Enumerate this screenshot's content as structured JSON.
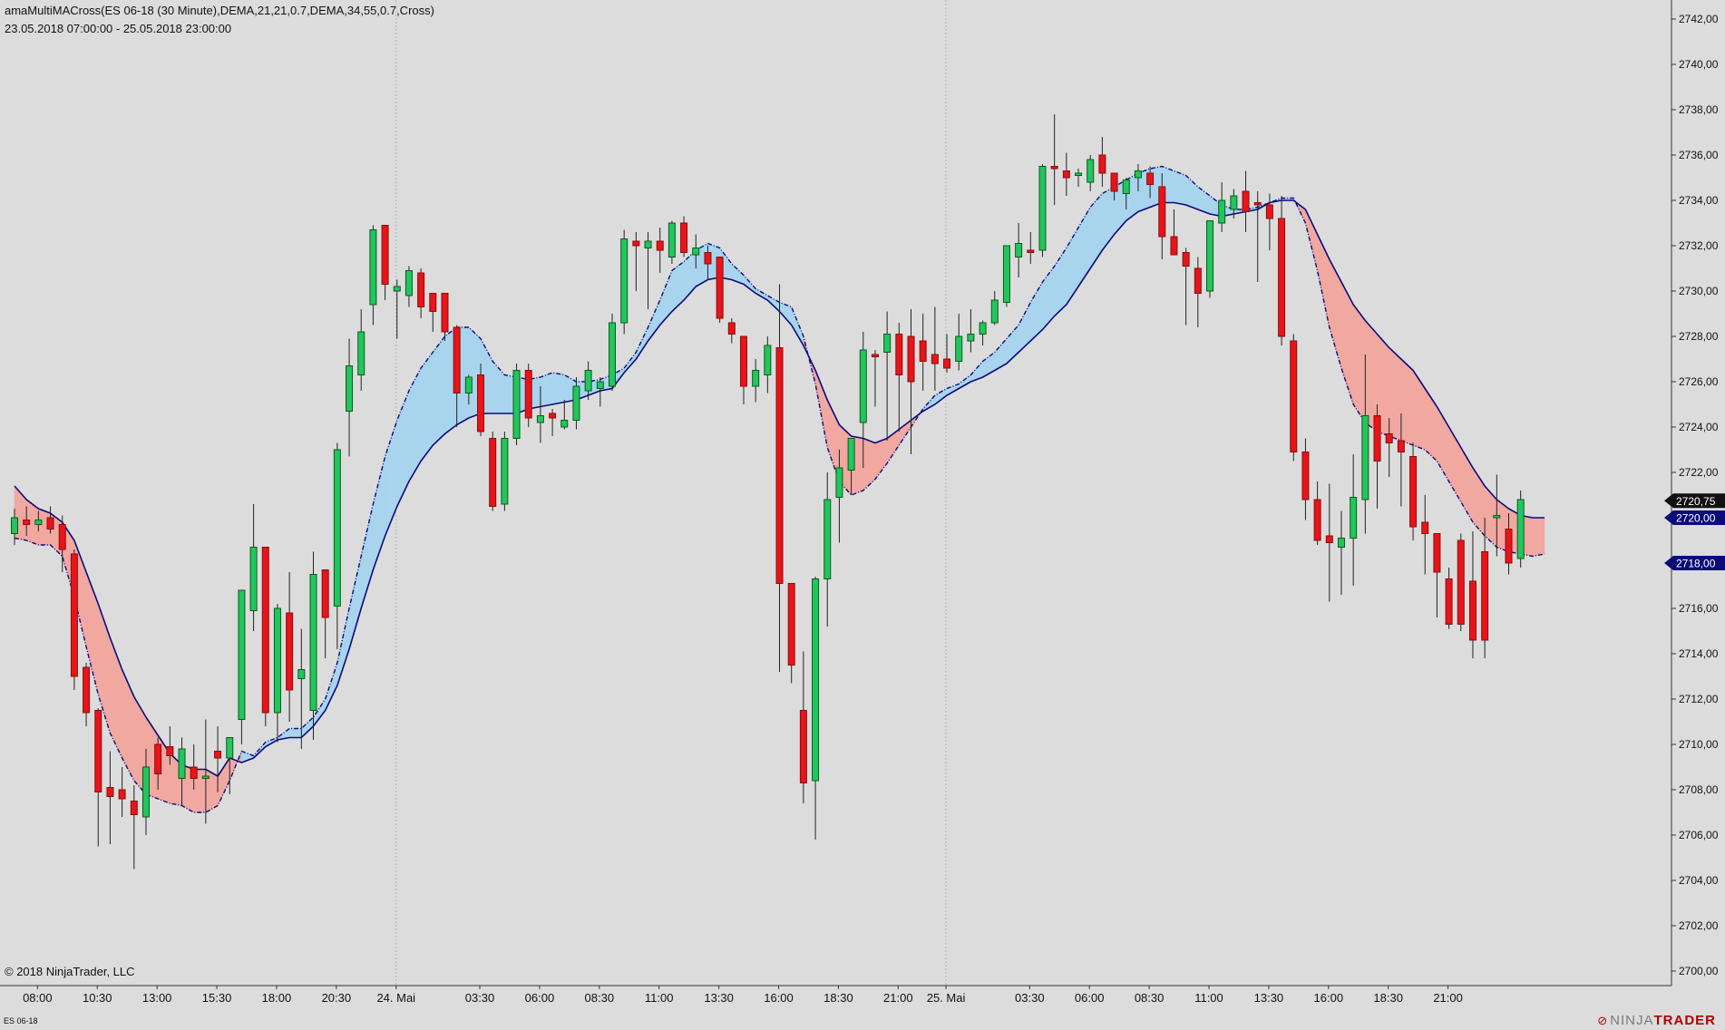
{
  "header": {
    "title": "amaMultiMACross(ES 06-18 (30 Minute),DEMA,21,21,0.7,DEMA,34,55,0.7,Cross)",
    "range": "23.05.2018 07:00:00 - 25.05.2018 23:00:00"
  },
  "footer": {
    "copyright": "© 2018 NinjaTrader, LLC",
    "instrument": "ES 06-18",
    "brand_prefix": "NINJA",
    "brand_suffix": "TRADER",
    "brand_mark": "⊘"
  },
  "colors": {
    "background": "#dcdcdc",
    "up_candle": "#22c55e",
    "up_candle_dark": "#0a5c17",
    "down_candle": "#e8141a",
    "down_candle_dark": "#8b0d0d",
    "bull_cloud": "#a8d4ee",
    "bear_cloud": "#f0a8a0",
    "ma_line": "#0b0b7a",
    "last_price_tag": "#111111",
    "ma_tag": "#0b0b7a"
  },
  "chart_data": {
    "type": "candlestick",
    "instrument": "ES 06-18",
    "interval": "30 Minute",
    "y_axis": {
      "min": 2699,
      "max": 2743,
      "tick_labels": [
        "2700,00",
        "2702,00",
        "2704,00",
        "2706,00",
        "2708,00",
        "2710,00",
        "2712,00",
        "2714,00",
        "2716,00",
        "2718,00",
        "2720,00",
        "2722,00",
        "2724,00",
        "2726,00",
        "2728,00",
        "2730,00",
        "2732,00",
        "2734,00",
        "2736,00",
        "2738,00",
        "2740,00",
        "2742,00"
      ],
      "tick_values": [
        2700,
        2702,
        2704,
        2706,
        2708,
        2710,
        2712,
        2714,
        2716,
        2718,
        2720,
        2722,
        2724,
        2726,
        2728,
        2730,
        2732,
        2734,
        2736,
        2738,
        2740,
        2742
      ]
    },
    "x_axis": {
      "tick_labels": [
        "08:00",
        "10:30",
        "13:00",
        "15:30",
        "18:00",
        "20:30",
        "24. Mai",
        "03:30",
        "06:00",
        "08:30",
        "11:00",
        "13:30",
        "16:00",
        "18:30",
        "21:00",
        "25. Mai",
        "03:30",
        "06:00",
        "08:30",
        "11:00",
        "13:30",
        "16:00",
        "18:30",
        "21:00"
      ],
      "tick_bars": [
        2,
        7,
        12,
        17,
        22,
        27,
        32,
        39,
        44,
        49,
        54,
        59,
        64,
        69,
        74,
        78,
        85,
        90,
        95,
        100,
        105,
        110,
        115,
        120
      ],
      "day_separators": [
        32,
        78
      ]
    },
    "candles": [
      {
        "o": 2719.3,
        "h": 2720.4,
        "l": 2718.8,
        "c": 2720.0
      },
      {
        "o": 2719.9,
        "h": 2720.5,
        "l": 2719.2,
        "c": 2719.7
      },
      {
        "o": 2719.7,
        "h": 2720.3,
        "l": 2719.4,
        "c": 2719.9
      },
      {
        "o": 2720.0,
        "h": 2720.5,
        "l": 2719.3,
        "c": 2719.5
      },
      {
        "o": 2719.7,
        "h": 2720.1,
        "l": 2717.6,
        "c": 2718.6
      },
      {
        "o": 2718.4,
        "h": 2718.6,
        "l": 2712.4,
        "c": 2713.0
      },
      {
        "o": 2713.4,
        "h": 2713.6,
        "l": 2710.8,
        "c": 2711.4
      },
      {
        "o": 2711.5,
        "h": 2711.6,
        "l": 2705.5,
        "c": 2707.9
      },
      {
        "o": 2708.1,
        "h": 2709.7,
        "l": 2705.6,
        "c": 2707.7
      },
      {
        "o": 2708.0,
        "h": 2709.0,
        "l": 2706.8,
        "c": 2707.6
      },
      {
        "o": 2707.5,
        "h": 2708.2,
        "l": 2704.5,
        "c": 2706.9
      },
      {
        "o": 2706.8,
        "h": 2709.8,
        "l": 2706.0,
        "c": 2709.0
      },
      {
        "o": 2710.0,
        "h": 2710.3,
        "l": 2708.0,
        "c": 2708.7
      },
      {
        "o": 2709.9,
        "h": 2710.8,
        "l": 2709.1,
        "c": 2709.5
      },
      {
        "o": 2708.5,
        "h": 2710.3,
        "l": 2707.3,
        "c": 2709.8
      },
      {
        "o": 2709.0,
        "h": 2710.0,
        "l": 2708.0,
        "c": 2708.5
      },
      {
        "o": 2708.5,
        "h": 2711.1,
        "l": 2706.5,
        "c": 2708.6
      },
      {
        "o": 2709.7,
        "h": 2710.8,
        "l": 2707.9,
        "c": 2709.4
      },
      {
        "o": 2709.4,
        "h": 2710.3,
        "l": 2707.8,
        "c": 2710.3
      },
      {
        "o": 2711.1,
        "h": 2711.5,
        "l": 2710.0,
        "c": 2716.8
      },
      {
        "o": 2715.9,
        "h": 2720.6,
        "l": 2715.0,
        "c": 2718.7
      },
      {
        "o": 2718.7,
        "h": 2718.7,
        "l": 2710.8,
        "c": 2711.4
      },
      {
        "o": 2711.4,
        "h": 2716.2,
        "l": 2710.1,
        "c": 2716.0
      },
      {
        "o": 2715.8,
        "h": 2717.6,
        "l": 2711.0,
        "c": 2712.4
      },
      {
        "o": 2712.9,
        "h": 2715.1,
        "l": 2709.8,
        "c": 2713.3
      },
      {
        "o": 2711.5,
        "h": 2718.5,
        "l": 2710.2,
        "c": 2717.5
      },
      {
        "o": 2717.7,
        "h": 2717.7,
        "l": 2713.8,
        "c": 2715.6
      },
      {
        "o": 2716.1,
        "h": 2723.3,
        "l": 2714.2,
        "c": 2723.0
      },
      {
        "o": 2724.7,
        "h": 2727.9,
        "l": 2722.7,
        "c": 2726.7
      },
      {
        "o": 2726.3,
        "h": 2729.2,
        "l": 2725.6,
        "c": 2728.2
      },
      {
        "o": 2729.4,
        "h": 2732.9,
        "l": 2728.5,
        "c": 2732.7
      },
      {
        "o": 2732.9,
        "h": 2732.9,
        "l": 2729.6,
        "c": 2730.3
      },
      {
        "o": 2730.0,
        "h": 2730.5,
        "l": 2727.9,
        "c": 2730.2
      },
      {
        "o": 2729.8,
        "h": 2731.1,
        "l": 2729.3,
        "c": 2730.9
      },
      {
        "o": 2730.8,
        "h": 2731.0,
        "l": 2728.8,
        "c": 2729.3
      },
      {
        "o": 2729.9,
        "h": 2729.9,
        "l": 2728.2,
        "c": 2729.1
      },
      {
        "o": 2729.9,
        "h": 2729.9,
        "l": 2727.8,
        "c": 2728.2
      },
      {
        "o": 2728.4,
        "h": 2728.5,
        "l": 2724.0,
        "c": 2725.5
      },
      {
        "o": 2725.5,
        "h": 2726.3,
        "l": 2725.0,
        "c": 2726.2
      },
      {
        "o": 2726.3,
        "h": 2726.8,
        "l": 2723.6,
        "c": 2723.8
      },
      {
        "o": 2723.5,
        "h": 2723.8,
        "l": 2720.3,
        "c": 2720.5
      },
      {
        "o": 2720.6,
        "h": 2723.8,
        "l": 2720.3,
        "c": 2723.5
      },
      {
        "o": 2723.5,
        "h": 2726.8,
        "l": 2723.2,
        "c": 2726.5
      },
      {
        "o": 2726.5,
        "h": 2726.8,
        "l": 2724.0,
        "c": 2724.4
      },
      {
        "o": 2724.2,
        "h": 2725.8,
        "l": 2723.3,
        "c": 2724.5
      },
      {
        "o": 2724.6,
        "h": 2724.8,
        "l": 2723.6,
        "c": 2724.4
      },
      {
        "o": 2724.0,
        "h": 2725.2,
        "l": 2723.9,
        "c": 2724.3
      },
      {
        "o": 2724.3,
        "h": 2726.2,
        "l": 2723.9,
        "c": 2725.8
      },
      {
        "o": 2725.6,
        "h": 2726.9,
        "l": 2725.2,
        "c": 2726.5
      },
      {
        "o": 2725.7,
        "h": 2726.2,
        "l": 2724.9,
        "c": 2726.0
      },
      {
        "o": 2725.8,
        "h": 2729.0,
        "l": 2725.6,
        "c": 2728.6
      },
      {
        "o": 2728.6,
        "h": 2732.7,
        "l": 2728.1,
        "c": 2732.3
      },
      {
        "o": 2732.2,
        "h": 2732.6,
        "l": 2730.0,
        "c": 2732.0
      },
      {
        "o": 2731.9,
        "h": 2732.6,
        "l": 2729.2,
        "c": 2732.2
      },
      {
        "o": 2732.2,
        "h": 2732.8,
        "l": 2730.8,
        "c": 2731.8
      },
      {
        "o": 2731.5,
        "h": 2733.1,
        "l": 2731.2,
        "c": 2733.0
      },
      {
        "o": 2733.0,
        "h": 2733.3,
        "l": 2731.5,
        "c": 2731.7
      },
      {
        "o": 2731.6,
        "h": 2732.5,
        "l": 2731.0,
        "c": 2731.9
      },
      {
        "o": 2731.7,
        "h": 2732.0,
        "l": 2730.5,
        "c": 2731.2
      },
      {
        "o": 2731.5,
        "h": 2731.5,
        "l": 2728.6,
        "c": 2728.8
      },
      {
        "o": 2728.6,
        "h": 2728.8,
        "l": 2727.7,
        "c": 2728.1
      },
      {
        "o": 2728.0,
        "h": 2728.0,
        "l": 2725.0,
        "c": 2725.8
      },
      {
        "o": 2725.8,
        "h": 2727.0,
        "l": 2725.1,
        "c": 2726.5
      },
      {
        "o": 2726.3,
        "h": 2728.0,
        "l": 2725.5,
        "c": 2727.6
      },
      {
        "o": 2727.5,
        "h": 2730.3,
        "l": 2713.2,
        "c": 2717.1
      },
      {
        "o": 2717.1,
        "h": 2717.1,
        "l": 2712.7,
        "c": 2713.5
      },
      {
        "o": 2711.5,
        "h": 2714.1,
        "l": 2707.4,
        "c": 2708.3
      },
      {
        "o": 2708.4,
        "h": 2717.4,
        "l": 2705.8,
        "c": 2717.3
      },
      {
        "o": 2717.3,
        "h": 2722.0,
        "l": 2715.2,
        "c": 2720.8
      },
      {
        "o": 2720.9,
        "h": 2723.0,
        "l": 2718.9,
        "c": 2722.2
      },
      {
        "o": 2722.1,
        "h": 2723.1,
        "l": 2721.0,
        "c": 2723.5
      },
      {
        "o": 2724.2,
        "h": 2728.2,
        "l": 2722.2,
        "c": 2727.4
      },
      {
        "o": 2727.2,
        "h": 2727.4,
        "l": 2724.9,
        "c": 2727.1
      },
      {
        "o": 2727.3,
        "h": 2729.1,
        "l": 2723.4,
        "c": 2728.1
      },
      {
        "o": 2728.1,
        "h": 2728.6,
        "l": 2723.8,
        "c": 2726.3
      },
      {
        "o": 2728.0,
        "h": 2729.2,
        "l": 2722.8,
        "c": 2726.0
      },
      {
        "o": 2727.8,
        "h": 2729.0,
        "l": 2725.6,
        "c": 2726.9
      },
      {
        "o": 2727.2,
        "h": 2729.3,
        "l": 2725.6,
        "c": 2726.8
      },
      {
        "o": 2727.0,
        "h": 2728.1,
        "l": 2726.4,
        "c": 2726.6
      },
      {
        "o": 2726.9,
        "h": 2729.0,
        "l": 2726.5,
        "c": 2728.0
      },
      {
        "o": 2727.8,
        "h": 2729.2,
        "l": 2727.3,
        "c": 2728.1
      },
      {
        "o": 2728.1,
        "h": 2728.7,
        "l": 2727.6,
        "c": 2728.6
      },
      {
        "o": 2728.6,
        "h": 2730.0,
        "l": 2728.5,
        "c": 2729.6
      },
      {
        "o": 2729.5,
        "h": 2731.6,
        "l": 2729.3,
        "c": 2732.0
      },
      {
        "o": 2731.5,
        "h": 2733.0,
        "l": 2730.6,
        "c": 2732.1
      },
      {
        "o": 2731.8,
        "h": 2732.6,
        "l": 2731.2,
        "c": 2731.7
      },
      {
        "o": 2731.8,
        "h": 2735.6,
        "l": 2731.5,
        "c": 2735.5
      },
      {
        "o": 2735.5,
        "h": 2737.8,
        "l": 2733.8,
        "c": 2735.4
      },
      {
        "o": 2735.3,
        "h": 2736.1,
        "l": 2734.2,
        "c": 2735.0
      },
      {
        "o": 2735.1,
        "h": 2735.4,
        "l": 2734.6,
        "c": 2735.2
      },
      {
        "o": 2734.8,
        "h": 2736.0,
        "l": 2734.4,
        "c": 2735.8
      },
      {
        "o": 2736.0,
        "h": 2736.8,
        "l": 2734.6,
        "c": 2735.2
      },
      {
        "o": 2735.2,
        "h": 2735.2,
        "l": 2734.0,
        "c": 2734.4
      },
      {
        "o": 2734.3,
        "h": 2735.0,
        "l": 2733.6,
        "c": 2734.9
      },
      {
        "o": 2735.0,
        "h": 2735.6,
        "l": 2734.4,
        "c": 2735.3
      },
      {
        "o": 2735.2,
        "h": 2735.5,
        "l": 2734.1,
        "c": 2734.7
      },
      {
        "o": 2734.6,
        "h": 2735.2,
        "l": 2731.4,
        "c": 2732.4
      },
      {
        "o": 2732.4,
        "h": 2733.6,
        "l": 2731.8,
        "c": 2731.6
      },
      {
        "o": 2731.7,
        "h": 2731.9,
        "l": 2728.5,
        "c": 2731.1
      },
      {
        "o": 2731.0,
        "h": 2731.5,
        "l": 2728.4,
        "c": 2729.9
      },
      {
        "o": 2730.0,
        "h": 2732.4,
        "l": 2729.7,
        "c": 2733.1
      },
      {
        "o": 2733.0,
        "h": 2734.8,
        "l": 2732.6,
        "c": 2734.0
      },
      {
        "o": 2733.6,
        "h": 2734.5,
        "l": 2733.2,
        "c": 2734.2
      },
      {
        "o": 2734.4,
        "h": 2735.3,
        "l": 2732.6,
        "c": 2733.5
      },
      {
        "o": 2733.9,
        "h": 2734.4,
        "l": 2730.4,
        "c": 2733.8
      },
      {
        "o": 2733.8,
        "h": 2734.3,
        "l": 2731.8,
        "c": 2733.2
      },
      {
        "o": 2733.2,
        "h": 2734.2,
        "l": 2727.6,
        "c": 2728.0
      },
      {
        "o": 2727.8,
        "h": 2728.1,
        "l": 2722.5,
        "c": 2722.9
      },
      {
        "o": 2722.9,
        "h": 2723.5,
        "l": 2719.9,
        "c": 2720.8
      },
      {
        "o": 2720.8,
        "h": 2721.6,
        "l": 2718.8,
        "c": 2719.0
      },
      {
        "o": 2719.2,
        "h": 2721.5,
        "l": 2716.3,
        "c": 2718.9
      },
      {
        "o": 2718.7,
        "h": 2720.3,
        "l": 2716.6,
        "c": 2719.1
      },
      {
        "o": 2719.1,
        "h": 2722.8,
        "l": 2717.0,
        "c": 2720.9
      },
      {
        "o": 2720.8,
        "h": 2727.2,
        "l": 2719.3,
        "c": 2724.5
      },
      {
        "o": 2724.5,
        "h": 2725.0,
        "l": 2720.4,
        "c": 2722.5
      },
      {
        "o": 2723.7,
        "h": 2724.4,
        "l": 2721.8,
        "c": 2723.3
      },
      {
        "o": 2723.4,
        "h": 2724.6,
        "l": 2720.5,
        "c": 2722.9
      },
      {
        "o": 2722.7,
        "h": 2723.3,
        "l": 2719.0,
        "c": 2719.6
      },
      {
        "o": 2719.8,
        "h": 2721.0,
        "l": 2717.5,
        "c": 2719.3
      },
      {
        "o": 2719.3,
        "h": 2719.3,
        "l": 2715.6,
        "c": 2717.6
      },
      {
        "o": 2717.3,
        "h": 2717.8,
        "l": 2715.1,
        "c": 2715.3
      },
      {
        "o": 2719.0,
        "h": 2719.3,
        "l": 2715.0,
        "c": 2715.3
      },
      {
        "o": 2717.2,
        "h": 2719.4,
        "l": 2713.8,
        "c": 2714.6
      },
      {
        "o": 2718.5,
        "h": 2720.0,
        "l": 2713.8,
        "c": 2714.6
      },
      {
        "o": 2720.0,
        "h": 2721.9,
        "l": 2718.3,
        "c": 2720.1
      },
      {
        "o": 2719.5,
        "h": 2720.2,
        "l": 2717.5,
        "c": 2718.0
      },
      {
        "o": 2718.2,
        "h": 2721.2,
        "l": 2717.8,
        "c": 2720.8
      }
    ],
    "fast_ma": [
      2719.1,
      2719.0,
      2718.8,
      2718.8,
      2718.3,
      2716.5,
      2714.3,
      2712.2,
      2710.5,
      2709.4,
      2708.4,
      2707.8,
      2707.6,
      2707.4,
      2707.3,
      2707.0,
      2707.0,
      2707.3,
      2708.4,
      2709.7,
      2709.5,
      2710.1,
      2710.3,
      2710.7,
      2710.7,
      2711.2,
      2712.0,
      2713.6,
      2716.0,
      2718.3,
      2720.6,
      2722.7,
      2724.3,
      2725.6,
      2726.6,
      2727.3,
      2728.0,
      2728.4,
      2728.4,
      2727.9,
      2726.9,
      2726.3,
      2726.2,
      2726.1,
      2726.2,
      2726.4,
      2726.3,
      2726.0,
      2726.0,
      2726.1,
      2726.3,
      2726.6,
      2727.3,
      2728.4,
      2729.6,
      2730.9,
      2731.3,
      2731.8,
      2732.1,
      2731.9,
      2731.2,
      2730.7,
      2730.1,
      2729.8,
      2729.5,
      2729.3,
      2728.0,
      2725.9,
      2723.1,
      2721.6,
      2721.0,
      2721.2,
      2721.7,
      2722.4,
      2723.2,
      2724.0,
      2724.8,
      2725.4,
      2725.7,
      2725.9,
      2726.3,
      2726.9,
      2727.3,
      2727.9,
      2728.5,
      2729.5,
      2730.4,
      2731.1,
      2731.9,
      2732.8,
      2733.7,
      2734.3,
      2734.6,
      2734.9,
      2735.2,
      2735.4,
      2735.5,
      2735.3,
      2735.1,
      2734.6,
      2734.2,
      2733.8,
      2733.6,
      2733.6,
      2733.7,
      2733.9,
      2734.1,
      2734.1,
      2733.0,
      2730.9,
      2728.4,
      2726.6,
      2725.0,
      2724.2,
      2723.8,
      2723.6,
      2723.4,
      2723.2,
      2723.0,
      2722.5,
      2721.6,
      2720.7,
      2719.8,
      2719.2,
      2718.7,
      2718.5,
      2718.4,
      2718.3,
      2718.4
    ],
    "slow_ma": [
      2721.4,
      2720.8,
      2720.4,
      2720.2,
      2719.8,
      2719.0,
      2717.6,
      2716.2,
      2714.7,
      2713.3,
      2712.1,
      2711.2,
      2710.4,
      2709.6,
      2709.1,
      2708.9,
      2708.9,
      2708.6,
      2709.4,
      2709.2,
      2709.4,
      2709.9,
      2710.2,
      2710.3,
      2710.3,
      2710.8,
      2711.5,
      2712.6,
      2714.2,
      2716.0,
      2717.7,
      2719.2,
      2720.5,
      2721.6,
      2722.5,
      2723.2,
      2723.7,
      2724.1,
      2724.4,
      2724.6,
      2724.6,
      2724.6,
      2724.6,
      2724.8,
      2724.9,
      2725.0,
      2725.1,
      2725.2,
      2725.4,
      2725.6,
      2725.7,
      2726.4,
      2727.0,
      2727.8,
      2728.5,
      2729.1,
      2729.6,
      2730.2,
      2730.5,
      2730.6,
      2730.5,
      2730.3,
      2729.9,
      2729.6,
      2729.1,
      2728.5,
      2727.6,
      2726.5,
      2725.2,
      2724.1,
      2723.6,
      2723.5,
      2723.3,
      2723.5,
      2723.9,
      2724.3,
      2724.7,
      2725.0,
      2725.4,
      2725.7,
      2726.0,
      2726.2,
      2726.5,
      2726.8,
      2727.3,
      2727.8,
      2728.3,
      2728.9,
      2729.4,
      2730.2,
      2731.0,
      2731.8,
      2732.5,
      2733.1,
      2733.5,
      2733.7,
      2733.9,
      2733.9,
      2733.8,
      2733.6,
      2733.4,
      2733.3,
      2733.4,
      2733.5,
      2733.6,
      2733.9,
      2734.0,
      2734.0,
      2733.6,
      2732.5,
      2731.4,
      2730.4,
      2729.4,
      2728.7,
      2728.1,
      2727.5,
      2727.0,
      2726.5,
      2725.7,
      2724.9,
      2724.0,
      2723.1,
      2722.2,
      2721.4,
      2720.8,
      2720.4,
      2720.1,
      2720.0,
      2720.0
    ],
    "price_tags": [
      {
        "label": "2720,75",
        "value": 2720.75,
        "kind": "last"
      },
      {
        "label": "2720,00",
        "value": 2720.0,
        "kind": "ma"
      },
      {
        "label": "2718,00",
        "value": 2718.0,
        "kind": "ma"
      }
    ]
  }
}
